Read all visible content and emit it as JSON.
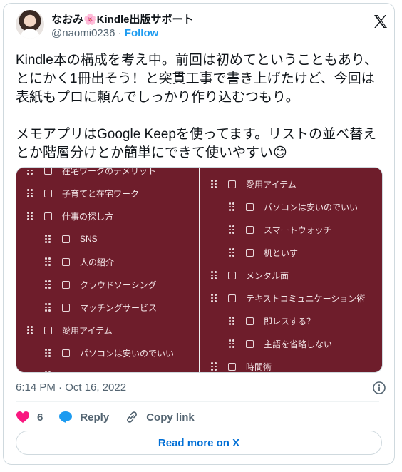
{
  "author": {
    "name": "なおみ🌸Kindle出版サポート",
    "handle": "@naomi0236",
    "separator": "·",
    "follow_label": "Follow"
  },
  "tweet": {
    "text": "Kindle本の構成を考え中。前回は初めてということもあり、とにかく1冊出そう！と突貫工事で書き上げたけど、今回は表紙もプロに頼んでしっかり作り込むつもり。\n\nメモアプリはGoogle Keepを使ってます。リストの並べ替えとか階層分けとか簡単にできて使いやすい😊"
  },
  "media": {
    "left_items": [
      {
        "label": "在宅ワークのデメリット",
        "indent": 0
      },
      {
        "label": "子育てと在宅ワーク",
        "indent": 0
      },
      {
        "label": "仕事の探し方",
        "indent": 0
      },
      {
        "label": "SNS",
        "indent": 1
      },
      {
        "label": "人の紹介",
        "indent": 1
      },
      {
        "label": "クラウドソーシング",
        "indent": 1
      },
      {
        "label": "マッチングサービス",
        "indent": 1
      },
      {
        "label": "愛用アイテム",
        "indent": 0
      },
      {
        "label": "パソコンは安いのでいい",
        "indent": 1
      },
      {
        "label": "スマートウォッチ",
        "indent": 1
      }
    ],
    "right_items": [
      {
        "label": "愛用アイテム",
        "indent": 0
      },
      {
        "label": "パソコンは安いのでいい",
        "indent": 1
      },
      {
        "label": "スマートウォッチ",
        "indent": 1
      },
      {
        "label": "机といす",
        "indent": 1
      },
      {
        "label": "メンタル面",
        "indent": 0
      },
      {
        "label": "テキストコミュニケーション術",
        "indent": 0
      },
      {
        "label": "即レスする？",
        "indent": 1
      },
      {
        "label": "主語を省略しない",
        "indent": 1
      },
      {
        "label": "時間術",
        "indent": 0
      }
    ],
    "colors": {
      "background": "#6e1d2b",
      "divider": "#f2f2f2"
    }
  },
  "timestamp": "6:14 PM · Oct 16, 2022",
  "actions": {
    "like_count": "6",
    "reply_label": "Reply",
    "copy_link_label": "Copy link"
  },
  "read_more_label": "Read more on X",
  "colors": {
    "accent": "#1d9bf0",
    "heart": "#f91880",
    "reply_icon": "#1d9bf0"
  }
}
